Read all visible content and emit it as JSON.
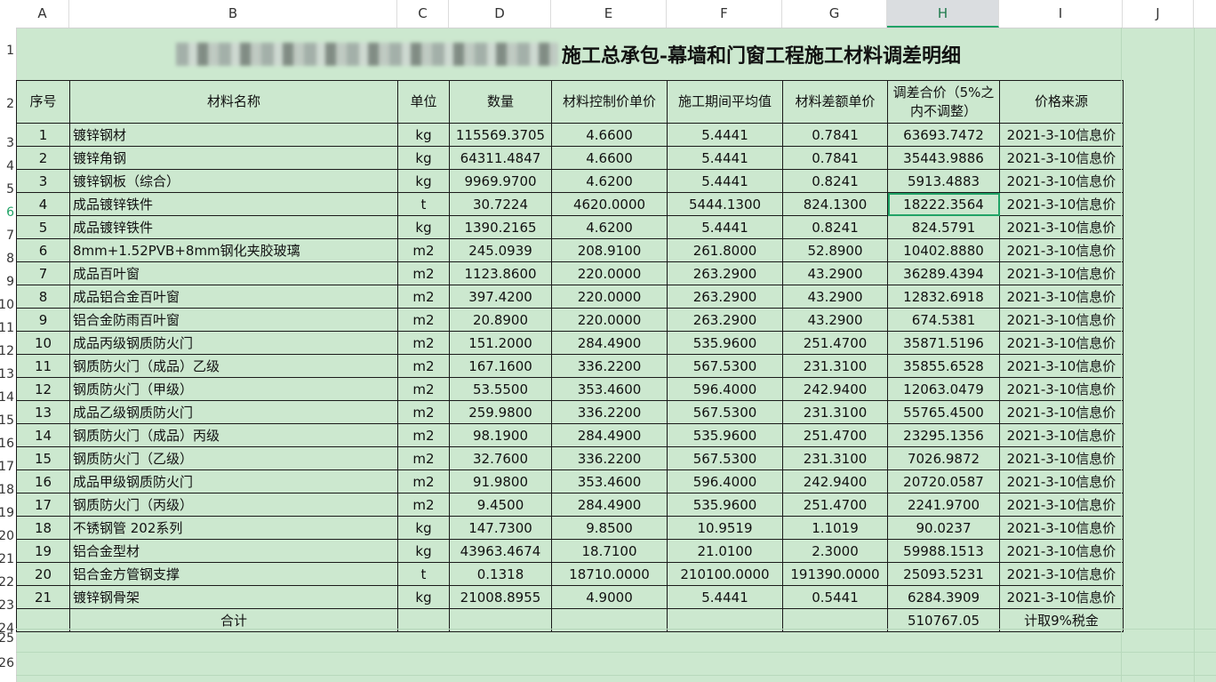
{
  "columns": [
    "A",
    "B",
    "C",
    "D",
    "E",
    "F",
    "G",
    "H",
    "I",
    "J"
  ],
  "selected_column": "H",
  "row_numbers": [
    "1",
    "2",
    "3",
    "4",
    "5",
    "6",
    "7",
    "8",
    "9",
    "10",
    "11",
    "12",
    "13",
    "14",
    "15",
    "16",
    "17",
    "18",
    "19",
    "20",
    "21",
    "22",
    "23",
    "24",
    "25",
    "26"
  ],
  "selected_row": "6",
  "title": "施工总承包-幕墙和门窗工程施工材料调差明细",
  "headers": [
    "序号",
    "材料名称",
    "单位",
    "数量",
    "材料控制价单价",
    "施工期间平均值",
    "材料差额单价",
    "调差合价（5%之内不调整）",
    "价格来源"
  ],
  "rows": [
    [
      "1",
      "镀锌钢材",
      "kg",
      "115569.3705",
      "4.6600",
      "5.4441",
      "0.7841",
      "63693.7472",
      "2021-3-10信息价"
    ],
    [
      "2",
      "镀锌角钢",
      "kg",
      "64311.4847",
      "4.6600",
      "5.4441",
      "0.7841",
      "35443.9886",
      "2021-3-10信息价"
    ],
    [
      "3",
      "镀锌钢板（综合）",
      "kg",
      "9969.9700",
      "4.6200",
      "5.4441",
      "0.8241",
      "5913.4883",
      "2021-3-10信息价"
    ],
    [
      "4",
      "成品镀锌铁件",
      "t",
      "30.7224",
      "4620.0000",
      "5444.1300",
      "824.1300",
      "18222.3564",
      "2021-3-10信息价"
    ],
    [
      "5",
      "成品镀锌铁件",
      "kg",
      "1390.2165",
      "4.6200",
      "5.4441",
      "0.8241",
      "824.5791",
      "2021-3-10信息价"
    ],
    [
      "6",
      "8mm+1.52PVB+8mm钢化夹胶玻璃",
      "m2",
      "245.0939",
      "208.9100",
      "261.8000",
      "52.8900",
      "10402.8880",
      "2021-3-10信息价"
    ],
    [
      "7",
      "成品百叶窗",
      "m2",
      "1123.8600",
      "220.0000",
      "263.2900",
      "43.2900",
      "36289.4394",
      "2021-3-10信息价"
    ],
    [
      "8",
      "成品铝合金百叶窗",
      "m2",
      "397.4200",
      "220.0000",
      "263.2900",
      "43.2900",
      "12832.6918",
      "2021-3-10信息价"
    ],
    [
      "9",
      "铝合金防雨百叶窗",
      "m2",
      "20.8900",
      "220.0000",
      "263.2900",
      "43.2900",
      "674.5381",
      "2021-3-10信息价"
    ],
    [
      "10",
      "成品丙级钢质防火门",
      "m2",
      "151.2000",
      "284.4900",
      "535.9600",
      "251.4700",
      "35871.5196",
      "2021-3-10信息价"
    ],
    [
      "11",
      "钢质防火门（成品）乙级",
      "m2",
      "167.1600",
      "336.2200",
      "567.5300",
      "231.3100",
      "35855.6528",
      "2021-3-10信息价"
    ],
    [
      "12",
      "钢质防火门（甲级）",
      "m2",
      "53.5500",
      "353.4600",
      "596.4000",
      "242.9400",
      "12063.0479",
      "2021-3-10信息价"
    ],
    [
      "13",
      "成品乙级钢质防火门",
      "m2",
      "259.9800",
      "336.2200",
      "567.5300",
      "231.3100",
      "55765.4500",
      "2021-3-10信息价"
    ],
    [
      "14",
      "钢质防火门（成品）丙级",
      "m2",
      "98.1900",
      "284.4900",
      "535.9600",
      "251.4700",
      "23295.1356",
      "2021-3-10信息价"
    ],
    [
      "15",
      "钢质防火门（乙级）",
      "m2",
      "32.7600",
      "336.2200",
      "567.5300",
      "231.3100",
      "7026.9872",
      "2021-3-10信息价"
    ],
    [
      "16",
      "成品甲级钢质防火门",
      "m2",
      "91.9800",
      "353.4600",
      "596.4000",
      "242.9400",
      "20720.0587",
      "2021-3-10信息价"
    ],
    [
      "17",
      "钢质防火门（丙级）",
      "m2",
      "9.4500",
      "284.4900",
      "535.9600",
      "251.4700",
      "2241.9700",
      "2021-3-10信息价"
    ],
    [
      "18",
      "不锈钢管 202系列",
      "kg",
      "147.7300",
      "9.8500",
      "10.9519",
      "1.1019",
      "90.0237",
      "2021-3-10信息价"
    ],
    [
      "19",
      "铝合金型材",
      "kg",
      "43963.4674",
      "18.7100",
      "21.0100",
      "2.3000",
      "59988.1513",
      "2021-3-10信息价"
    ],
    [
      "20",
      "铝合金方管钢支撑",
      "t",
      "0.1318",
      "18710.0000",
      "210100.0000",
      "191390.0000",
      "25093.5231",
      "2021-3-10信息价"
    ],
    [
      "21",
      "镀锌钢骨架",
      "kg",
      "21008.8955",
      "4.9000",
      "5.4441",
      "0.5441",
      "6284.3909",
      "2021-3-10信息价"
    ]
  ],
  "total_row": {
    "label": "合计",
    "amount": "510767.05",
    "note": "计取9%税金"
  },
  "colors": {
    "sheet_bg": "#cce8cf",
    "selection": "#21a366"
  }
}
